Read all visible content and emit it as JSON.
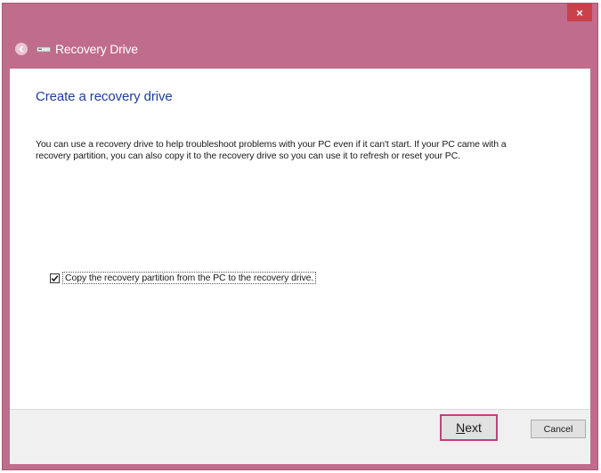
{
  "window": {
    "title": "Recovery Drive",
    "close_label": "×",
    "frame_color": "#c06c8c"
  },
  "main": {
    "heading": "Create a recovery drive",
    "description": "You can use a recovery drive to help troubleshoot problems with your PC even if it can't start. If your PC came with a recovery partition, you can also copy it to the recovery drive so you can use it to refresh or reset your PC.",
    "checkbox": {
      "label": "Copy the recovery partition from the PC to the recovery drive.",
      "checked": true
    }
  },
  "footer": {
    "next_accel": "N",
    "next_rest": "ext",
    "cancel_label": "Cancel"
  },
  "icons": [
    "back-arrow-icon",
    "drive-icon",
    "close-icon",
    "checkmark-icon"
  ]
}
